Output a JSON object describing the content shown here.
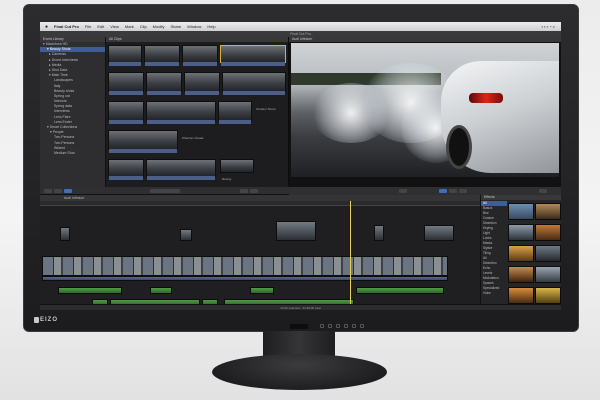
{
  "colors": {
    "accent": "#3f5e96",
    "audio": "#4f9a44",
    "video_track": "#4b5f89",
    "bezel": "#1c1c1e"
  },
  "menubar": {
    "app_name": "Final Cut Pro",
    "items": [
      "File",
      "Edit",
      "View",
      "Mark",
      "Clip",
      "Modify",
      "Share",
      "Window",
      "Help"
    ]
  },
  "window": {
    "title": "Final Cut Pro"
  },
  "library": {
    "header": "Event Library",
    "items": [
      "Macintosh HD",
      "Beauty Shots",
      "Cameras",
      "Drone Interviews",
      "Media",
      "Shot Data",
      "Main Time",
      "Landscapes",
      "Italy",
      "Beauty shots",
      "Spring car",
      "Interiors",
      "Spring data",
      "Interviews",
      "Lens Flare",
      "Lens Ender",
      "Smart Collections",
      "People",
      "Two Persons",
      "Two Persons",
      "Widest",
      "Medium Shot"
    ]
  },
  "browser": {
    "header": "All Clips",
    "labels": [
      "Outdoor Shoot",
      "Phantom Ahead",
      "Racing"
    ]
  },
  "viewer": {
    "header": "Audi Infinium"
  },
  "timeline": {
    "header": "Audi Infinium"
  },
  "effects": {
    "header": "Effects",
    "categories": [
      "All",
      "Basics",
      "Blur",
      "Custom",
      "Distortion",
      "Keying",
      "Light",
      "Looks",
      "Masks",
      "Stylize",
      "Tiling",
      "All",
      "Distortion",
      "Echo",
      "Levels",
      "Modulation",
      "Spaces",
      "Specialized",
      "Voice"
    ]
  },
  "statusbar": {
    "text": "20:00 selected - 01:38:00 total"
  }
}
